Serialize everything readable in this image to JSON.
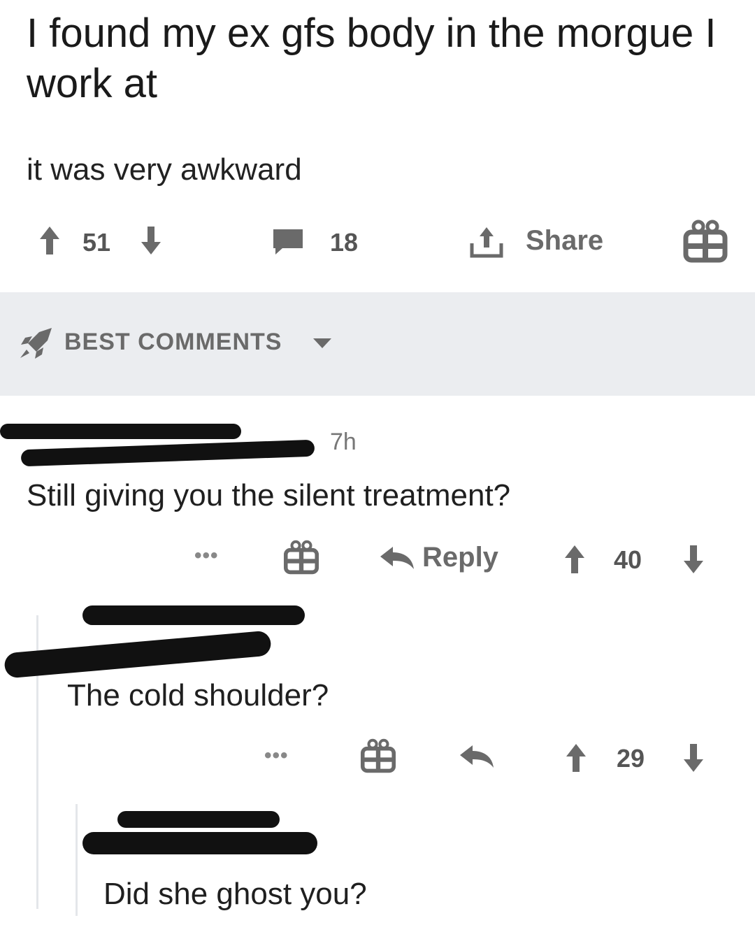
{
  "post": {
    "title": "I found my ex gfs body in the morgue I work at",
    "body": "it was very awkward",
    "upvotes": "51",
    "comments": "18",
    "share_label": "Share"
  },
  "sort": {
    "label": "BEST COMMENTS"
  },
  "comments": [
    {
      "time": "7h",
      "text": "Still giving you the silent treatment?",
      "reply_label": "Reply",
      "votes": "40"
    },
    {
      "text": "The cold shoulder?",
      "votes": "29"
    },
    {
      "text": "Did she ghost you?"
    }
  ],
  "colors": {
    "band": "#ebedf0",
    "icon": "#6a6a6a"
  },
  "icons": [
    "upvote-arrow",
    "downvote-arrow",
    "comment-bubble",
    "share-upload",
    "gift-box",
    "rocket",
    "caret-down",
    "reply-arrow",
    "more-dots"
  ]
}
